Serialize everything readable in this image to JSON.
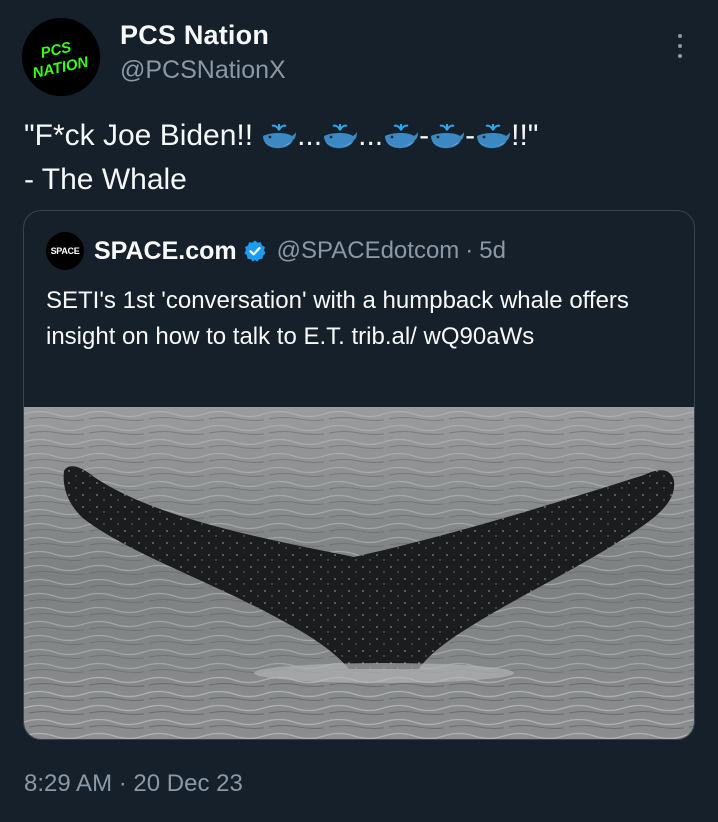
{
  "author": {
    "display_name": "PCS Nation",
    "handle": "@PCSNationX",
    "avatar_text": "PCS NATION",
    "avatar_color": "#39ff14"
  },
  "tweet": {
    "line1_prefix": "\"F*ck Joe Biden!!",
    "line1_suffix": "!!\"",
    "dots": "...",
    "dash": "-",
    "line2": "- The Whale",
    "emoji_name": "spouting-whale-icon"
  },
  "quote": {
    "avatar_text": "SPACE",
    "display_name": "SPACE.com",
    "handle": "@SPACEdotcom",
    "separator": "·",
    "time": "5d",
    "text": "SETI's 1st 'conversation' with a humpback whale offers insight on how to talk to E.T. trib.al/ wQ90aWs",
    "verified_color": "#1d9bf0",
    "media": "whale-tail-photo"
  },
  "timestamp": {
    "time": "8:29 AM",
    "separator": "·",
    "date": "20 Dec 23"
  },
  "menu": {
    "icon": "more-options-icon"
  }
}
